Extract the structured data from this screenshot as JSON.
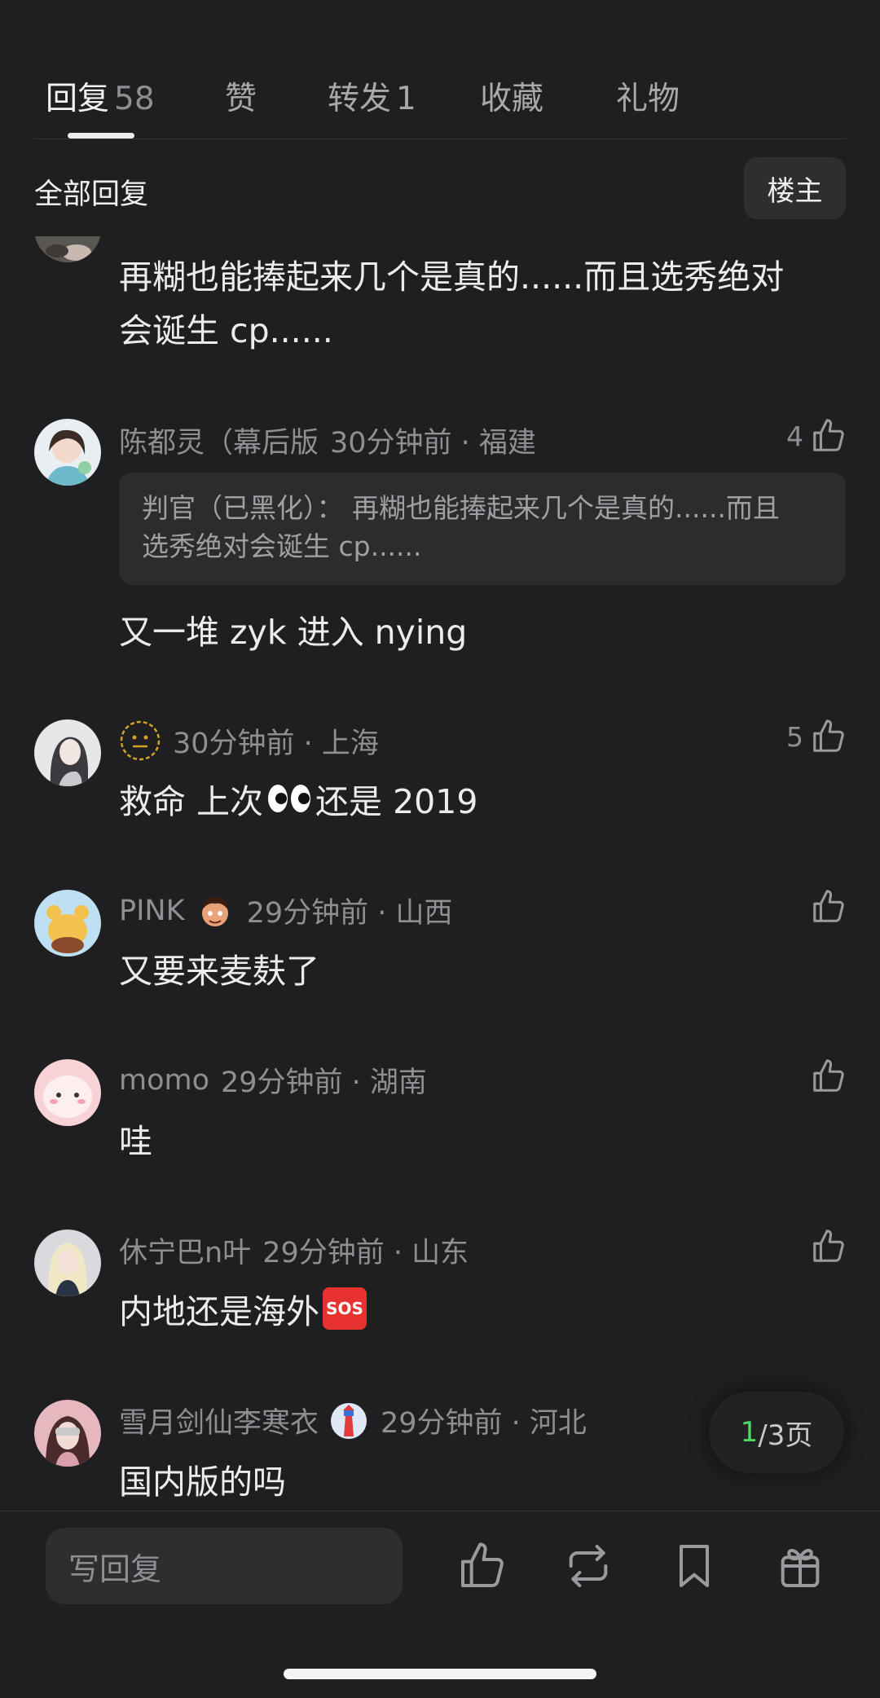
{
  "tabs": [
    {
      "label": "回复",
      "count": "58"
    },
    {
      "label": "赞",
      "count": ""
    },
    {
      "label": "转发",
      "count": "1"
    },
    {
      "label": "收藏",
      "count": ""
    },
    {
      "label": "礼物",
      "count": ""
    }
  ],
  "filter": {
    "label": "全部回复",
    "host_label": "楼主"
  },
  "partial_comment": {
    "line1": "再糊也能捧起来几个是真的......而且选秀绝对",
    "line2": "会诞生 cp......"
  },
  "comments": [
    {
      "name": "陈都灵（幕后版",
      "time": "30分钟前 · 福建",
      "likes": "4",
      "quote_line1": "判官（已黑化）：  再糊也能捧起来几个是真的......而且",
      "quote_line2": "选秀绝对会诞生 cp......",
      "text": "又一堆 zyk 进入 nying"
    },
    {
      "name": "",
      "time": "30分钟前 · 上海",
      "likes": "5",
      "text_before": "救命 上次",
      "text_after": "还是 2019"
    },
    {
      "name": "PINK",
      "time": "29分钟前 · 山西",
      "likes": "",
      "text": "又要来麦麸了"
    },
    {
      "name": "momo",
      "time": "29分钟前 · 湖南",
      "likes": "",
      "text": "哇"
    },
    {
      "name": "休宁巴n叶",
      "time": "29分钟前 · 山东",
      "likes": "",
      "text": "内地还是海外",
      "emoji_label": "SOS"
    },
    {
      "name": "雪月剑仙李寒衣",
      "time": "29分钟前 · 河北",
      "likes": "",
      "text": "国内版的吗"
    }
  ],
  "pagination": {
    "current": "1",
    "total": "/3页"
  },
  "bottom_bar": {
    "reply_placeholder": "写回复"
  },
  "icons": [
    "thumbs-up-icon",
    "repost-icon",
    "bookmark-icon",
    "gift-icon"
  ],
  "colors": {
    "background": "#1f1f21",
    "text": "#ececec",
    "muted": "#8e8e93",
    "page_current": "#4cd964"
  }
}
